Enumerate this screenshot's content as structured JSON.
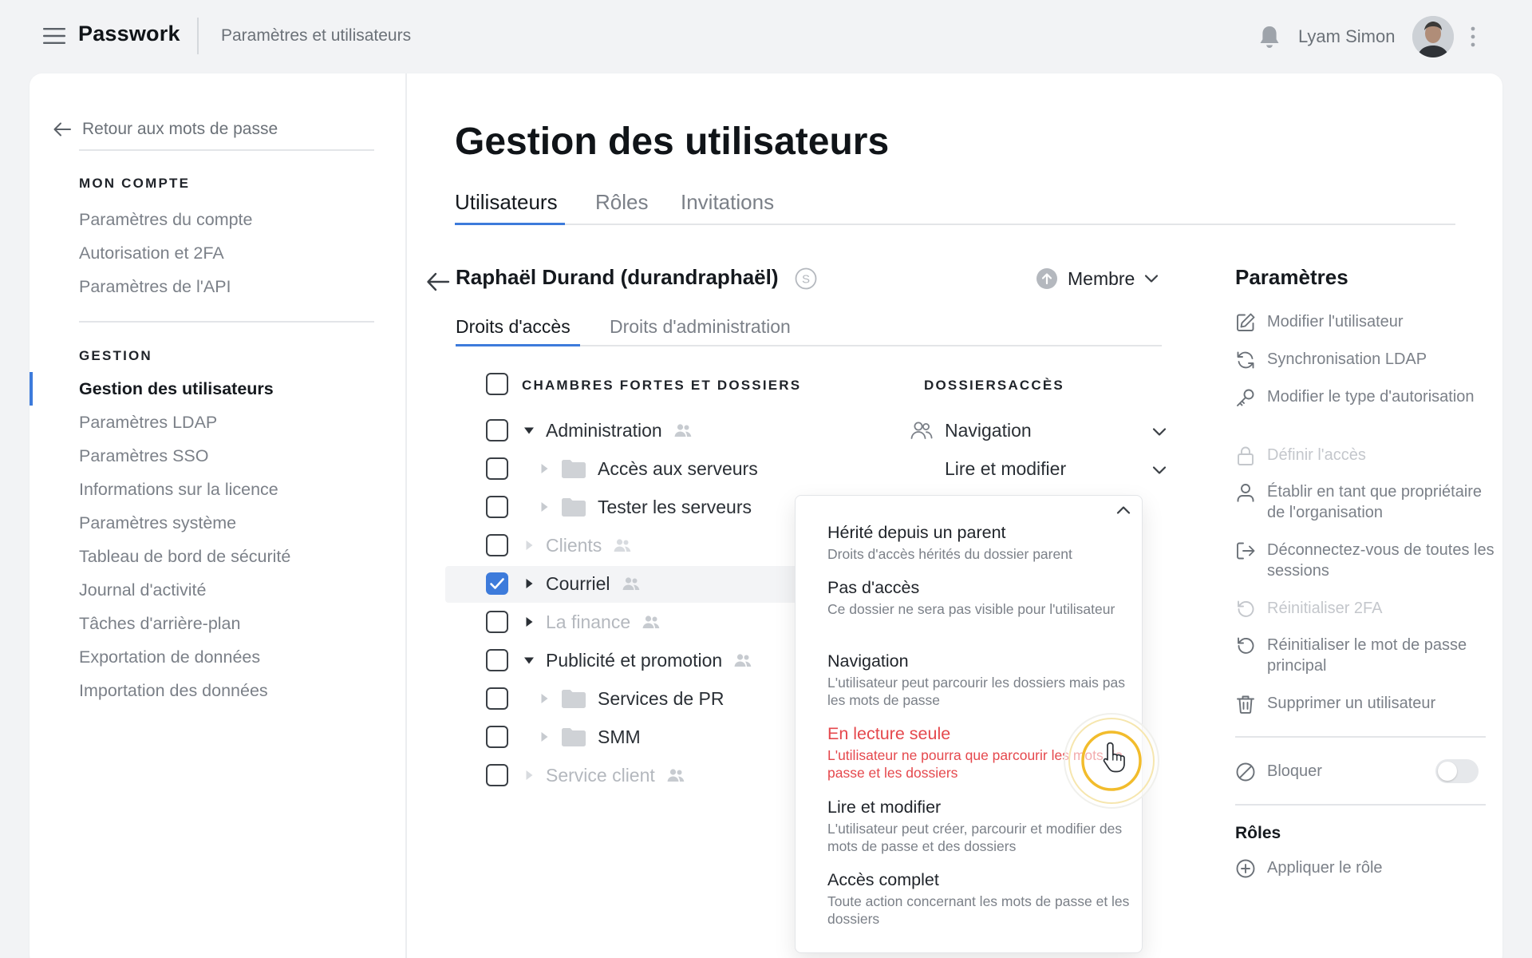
{
  "topbar": {
    "brand": "Passwork",
    "breadcrumb": "Paramètres et utilisateurs",
    "user_name": "Lyam Simon",
    "icons": [
      "menu-icon",
      "bell-icon",
      "avatar",
      "kebab-icon"
    ]
  },
  "sidebar": {
    "back_label": "Retour aux mots de passe",
    "account_heading": "MON COMPTE",
    "account_items": [
      {
        "label": "Paramètres du compte"
      },
      {
        "label": "Autorisation et 2FA"
      },
      {
        "label": "Paramètres de l'API"
      }
    ],
    "management_heading": "GESTION",
    "management_items": [
      {
        "label": "Gestion des utilisateurs",
        "active": true
      },
      {
        "label": "Paramètres LDAP"
      },
      {
        "label": "Paramètres SSO"
      },
      {
        "label": "Informations sur la licence"
      },
      {
        "label": "Paramètres système"
      },
      {
        "label": "Tableau de bord de sécurité"
      },
      {
        "label": "Journal d'activité"
      },
      {
        "label": "Tâches d'arrière-plan"
      },
      {
        "label": "Exportation de données"
      },
      {
        "label": "Importation des données"
      }
    ]
  },
  "main": {
    "title": "Gestion des utilisateurs",
    "tabs": [
      {
        "label": "Utilisateurs",
        "active": true
      },
      {
        "label": "Rôles"
      },
      {
        "label": "Invitations"
      }
    ],
    "user": {
      "name": "Raphaël Durand (durandraphaël)",
      "badge": "S",
      "role": "Membre"
    },
    "subtabs": [
      {
        "label": "Droits d'accès",
        "active": true
      },
      {
        "label": "Droits d'administration"
      }
    ],
    "tree": {
      "column_vaults": "CHAMBRES FORTES ET DOSSIERS",
      "column_access": "DOSSIERSACCÈS",
      "rows": [
        {
          "label": "Administration",
          "checked": false,
          "muted": false,
          "expanded": true,
          "folder": false,
          "shared": true
        },
        {
          "label": "Accès aux serveurs",
          "checked": false,
          "muted": false,
          "expanded": false,
          "folder": true,
          "shared": false
        },
        {
          "label": "Tester les serveurs",
          "checked": false,
          "muted": false,
          "expanded": false,
          "folder": true,
          "shared": false
        },
        {
          "label": "Clients",
          "checked": false,
          "muted": true,
          "expanded": false,
          "folder": false,
          "shared": true
        },
        {
          "label": "Courriel",
          "checked": true,
          "muted": false,
          "expanded": false,
          "folder": false,
          "shared": true
        },
        {
          "label": "La finance",
          "checked": false,
          "muted": true,
          "expanded": false,
          "folder": false,
          "shared": true
        },
        {
          "label": "Publicité et promotion",
          "checked": false,
          "muted": false,
          "expanded": true,
          "folder": false,
          "shared": true
        },
        {
          "label": "Services de PR",
          "checked": false,
          "muted": false,
          "expanded": false,
          "folder": true,
          "shared": false
        },
        {
          "label": "SMM",
          "checked": false,
          "muted": false,
          "expanded": false,
          "folder": true,
          "shared": false
        },
        {
          "label": "Service client",
          "checked": false,
          "muted": true,
          "expanded": false,
          "folder": false,
          "shared": true
        }
      ],
      "access_values": [
        {
          "label": "Navigation"
        },
        {
          "label": "Lire et modifier"
        }
      ]
    },
    "dropdown": {
      "options": [
        {
          "title": "Hérité depuis un parent",
          "desc": "Droits d'accès hérités du dossier parent"
        },
        {
          "title": "Pas d'accès",
          "desc": "Ce dossier ne sera pas visible pour l'utilisateur"
        },
        {
          "title": "Navigation",
          "desc": "L'utilisateur peut parcourir les dossiers mais pas les mots de passe"
        },
        {
          "title": "En lecture seule",
          "desc": "L'utilisateur ne pourra que parcourir les mots de passe et les dossiers",
          "highlight": true
        },
        {
          "title": "Lire et modifier",
          "desc": "L'utilisateur peut créer, parcourir et modifier des mots de passe et des dossiers"
        },
        {
          "title": "Accès complet",
          "desc": "Toute action concernant les mots de passe et les dossiers"
        }
      ],
      "accent_color": "#e5484d"
    }
  },
  "params": {
    "title": "Paramètres",
    "items": [
      {
        "label": "Modifier l'utilisateur",
        "icon": "edit-icon"
      },
      {
        "label": "Synchronisation LDAP",
        "icon": "sync-icon"
      },
      {
        "label": "Modifier le type d'autorisation",
        "icon": "key-icon"
      },
      {
        "label": "Définir l'accès",
        "icon": "lock-icon",
        "disabled": true
      },
      {
        "label": "Établir en tant que propriétaire de l'organisation",
        "icon": "user-icon"
      },
      {
        "label": "Déconnectez-vous de toutes les sessions",
        "icon": "logout-icon"
      },
      {
        "label": "Réinitialiser 2FA",
        "icon": "reset-icon",
        "disabled": true
      },
      {
        "label": "Réinitialiser le mot de passe principal",
        "icon": "reset-icon"
      },
      {
        "label": "Supprimer un utilisateur",
        "icon": "trash-icon"
      }
    ],
    "block_label": "Bloquer",
    "block_enabled": false,
    "roles_heading": "Rôles",
    "apply_role_label": "Appliquer le rôle"
  },
  "colors": {
    "accent": "#3d7bdb",
    "danger": "#e5484d",
    "muted_text": "#7b8088"
  }
}
